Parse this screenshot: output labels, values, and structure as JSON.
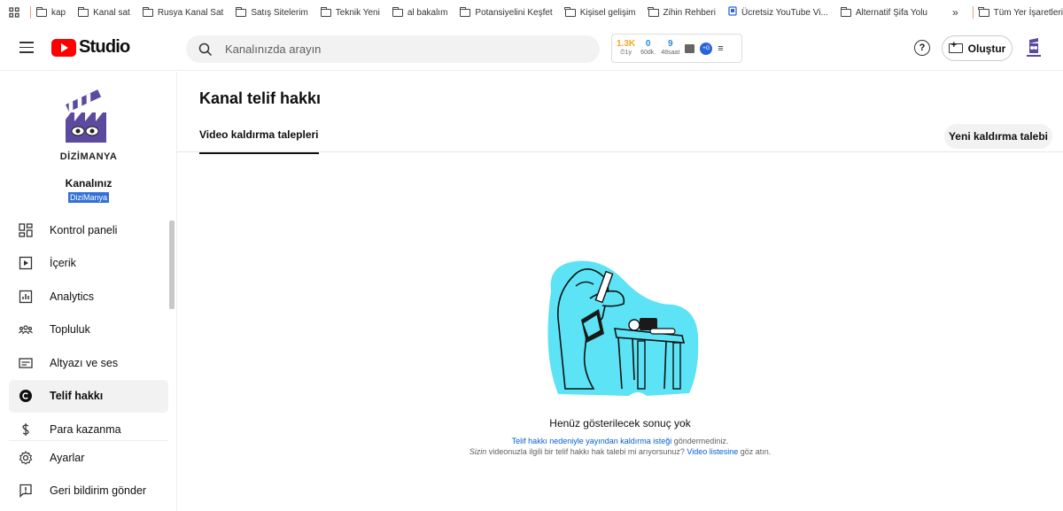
{
  "bookmarks": {
    "items": [
      "kap",
      "Kanal sat",
      "Rusya Kanal Sat",
      "Satış Sitelerim",
      "Teknik Yeni",
      "al bakalım",
      "Potansiyelini Keşfet",
      "Kişisel gelişim",
      "Zihin Rehberi",
      "Ücretsiz YouTube Vi...",
      "Alternatif Şifa Yolu"
    ],
    "more": "»",
    "all_label": "Tüm Yer İşaretleri"
  },
  "header": {
    "logo_text": "Studio",
    "search_placeholder": "Kanalınızda arayın",
    "ext": {
      "stat1_value": "1.3K",
      "stat1_label": "⏱1y",
      "stat2_value": "0",
      "stat2_label": "60dk.",
      "stat3_value": "9",
      "stat3_label": "48saat",
      "circle_text": "+G"
    },
    "help_symbol": "?",
    "create_label": "Oluştur"
  },
  "sidebar": {
    "channel_logo_text": "DİZİMANYA",
    "channel_label": "Kanalınız",
    "channel_handle": "DiziManya",
    "items": [
      {
        "label": "Kontrol paneli"
      },
      {
        "label": "İçerik"
      },
      {
        "label": "Analytics"
      },
      {
        "label": "Topluluk"
      },
      {
        "label": "Altyazı ve ses"
      },
      {
        "label": "Telif hakkı"
      },
      {
        "label": "Para kazanma"
      }
    ],
    "bottom_items": [
      {
        "label": "Ayarlar"
      },
      {
        "label": "Geri bildirim gönder"
      }
    ]
  },
  "main": {
    "title": "Kanal telif hakkı",
    "tab_label": "Video kaldırma talepleri",
    "new_request_label": "Yeni kaldırma talebi",
    "empty_title": "Henüz gösterilecek sonuç yok",
    "line1_link": "Telif hakkı nedeniyle yayından kaldırma isteği",
    "line1_rest": " göndermediniz.",
    "line2_italic": "Sizin",
    "line2_mid": " videonuzla ilgili bir telif hakkı hak talebi mi arıyorsunuz? ",
    "line2_link": "Video listesine",
    "line2_end": " göz atın."
  },
  "colors": {
    "accent_red": "#ff0000",
    "link_blue": "#065fd4",
    "illustration_cyan": "#5ce3f5",
    "handle_highlight": "#3370d6"
  }
}
